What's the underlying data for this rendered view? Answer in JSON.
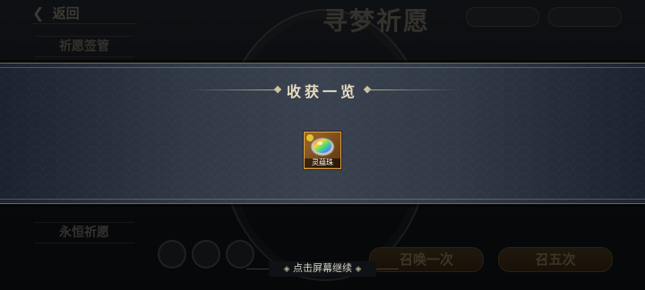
{
  "popup": {
    "title": "收获一览",
    "reward": {
      "name": "灵蕴珠",
      "icon": "rainbow-gem-icon"
    },
    "hint": "点击屏幕继续"
  },
  "background": {
    "back_label": "返回",
    "title": "寻梦祈愿",
    "side_button_top": "祈愿签管",
    "side_button_bottom": "永恒祈愿",
    "draw_one": "召唤一次",
    "draw_five": "召五次"
  },
  "colors": {
    "accent": "#e6dcc0",
    "item_frame": "#d9a040",
    "panel": "#3a4250"
  }
}
